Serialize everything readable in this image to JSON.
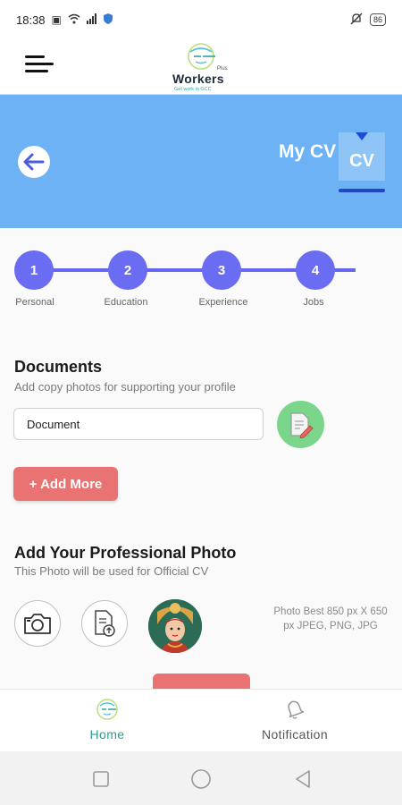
{
  "status_bar": {
    "time": "18:38",
    "battery": "86",
    "icons": [
      "image-icon",
      "wifi-icon",
      "signal-icon",
      "shield-icon",
      "mute-icon",
      "battery-icon"
    ]
  },
  "header": {
    "menu_icon": "hamburger-menu-icon",
    "logo": {
      "brand": "Workers",
      "plus": "Plus",
      "tagline": "Get work in GCC"
    }
  },
  "banner": {
    "title": "My CV",
    "badge": "CV",
    "back_icon": "arrow-left-icon",
    "color": "#6cb2f5"
  },
  "stepper": {
    "steps": [
      {
        "number": "1",
        "label": "Personal"
      },
      {
        "number": "2",
        "label": "Education"
      },
      {
        "number": "3",
        "label": "Experience"
      },
      {
        "number": "4",
        "label": "Jobs"
      }
    ],
    "color": "#6a6cf2"
  },
  "documents": {
    "title": "Documents",
    "subtitle": "Add copy photos for supporting your profile",
    "input_value": "Document",
    "upload_icon": "document-edit-icon",
    "add_more": "+ Add More"
  },
  "photo": {
    "title": "Add Your Professional Photo",
    "subtitle": "This Photo will be used for Official CV",
    "camera_icon": "camera-icon",
    "file_icon": "file-upload-icon",
    "note": "Photo Best 850 px X 650 px JPEG, PNG, JPG"
  },
  "tabs": [
    {
      "label": "Home",
      "icon": "home-icon",
      "active": true,
      "color": "#2a9d8f"
    },
    {
      "label": "Notification",
      "icon": "bell-icon",
      "active": false,
      "color": "#555555"
    }
  ],
  "nav": {
    "icons": [
      "square-icon",
      "circle-icon",
      "triangle-back-icon"
    ]
  },
  "colors": {
    "accent_red": "#e87372",
    "upload_green": "#7bd68c"
  }
}
